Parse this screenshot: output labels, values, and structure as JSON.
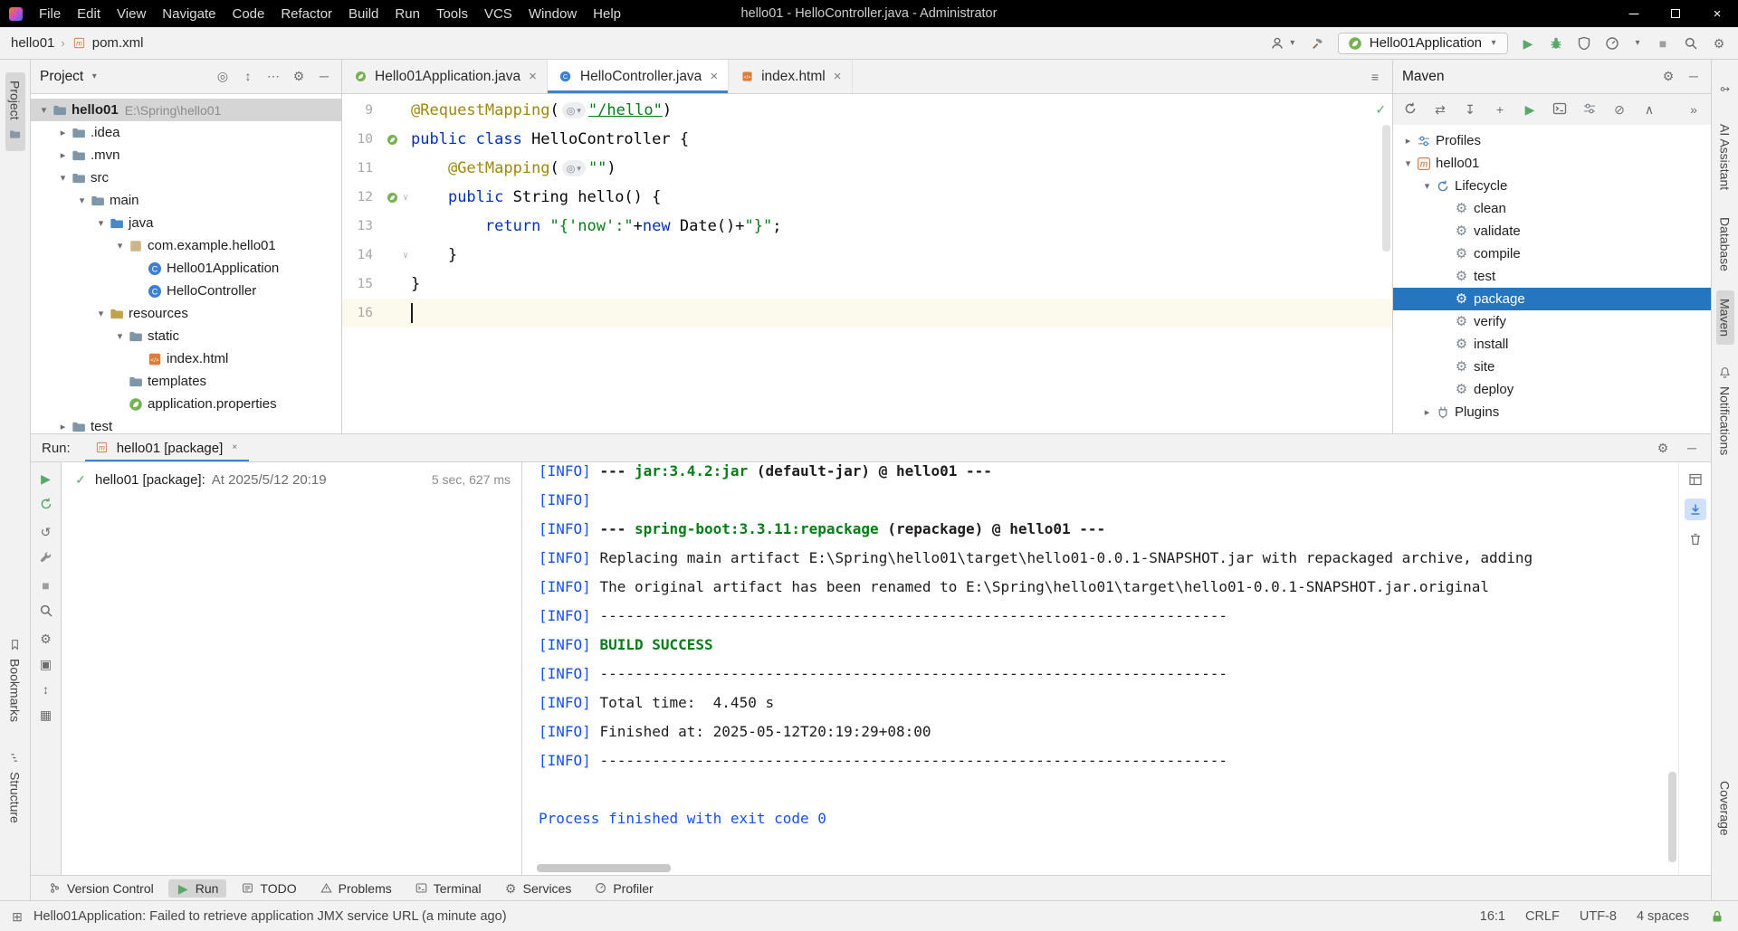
{
  "colors": {
    "accent": "#4083c9",
    "selection_blue": "#2675bf",
    "success_green": "#067d17",
    "info_blue": "#1750eb",
    "keyword_blue": "#0033b3",
    "annotation_olive": "#9e880d"
  },
  "title_bar": {
    "title": "hello01 - HelloController.java - Administrator",
    "menus": [
      "File",
      "Edit",
      "View",
      "Navigate",
      "Code",
      "Refactor",
      "Build",
      "Run",
      "Tools",
      "VCS",
      "Window",
      "Help"
    ]
  },
  "navbar": {
    "breadcrumbs": [
      {
        "label": "hello01",
        "icon": null
      },
      {
        "label": "pom.xml",
        "icon": "maven"
      }
    ],
    "run_config_label": "Hello01Application"
  },
  "stripes": {
    "left_top": [
      {
        "label": "Project",
        "icon": "project",
        "selected": true,
        "icon_after": true
      }
    ],
    "left_bottom": [
      {
        "label": "Bookmarks",
        "icon": "bookmark"
      },
      {
        "label": "Structure",
        "icon": "structure"
      }
    ],
    "right_top": [
      {
        "label": "",
        "icon": "endpoints"
      },
      {
        "label": "AI Assistant",
        "icon": null
      },
      {
        "label": "Database",
        "icon": null
      },
      {
        "label": "Maven",
        "icon": null,
        "selected": true
      },
      {
        "label": "Notifications",
        "icon": "bell"
      }
    ],
    "right_bottom": [
      {
        "label": "Coverage",
        "icon": null
      }
    ]
  },
  "project_panel": {
    "title": "Project",
    "header_icons": [
      "select-target",
      "expand-collapse",
      "view-options",
      "settings",
      "hide"
    ],
    "tree": [
      {
        "indent": 0,
        "chevron": "down",
        "icon": "folder",
        "label": "hello01",
        "path": "E:\\Spring\\hello01",
        "selected": true,
        "bold": true
      },
      {
        "indent": 1,
        "chevron": "right",
        "icon": "folder",
        "label": ".idea"
      },
      {
        "indent": 1,
        "chevron": "right",
        "icon": "folder",
        "label": ".mvn"
      },
      {
        "indent": 1,
        "chevron": "down",
        "icon": "folder",
        "label": "src"
      },
      {
        "indent": 2,
        "chevron": "down",
        "icon": "folder",
        "label": "main"
      },
      {
        "indent": 3,
        "chevron": "down",
        "icon": "folder-source",
        "label": "java"
      },
      {
        "indent": 4,
        "chevron": "down",
        "icon": "package",
        "label": "com.example.hello01"
      },
      {
        "indent": 5,
        "chevron": null,
        "icon": "class",
        "label": "Hello01Application"
      },
      {
        "indent": 5,
        "chevron": null,
        "icon": "class",
        "label": "HelloController"
      },
      {
        "indent": 3,
        "chevron": "down",
        "icon": "folder-resources",
        "label": "resources"
      },
      {
        "indent": 4,
        "chevron": "down",
        "icon": "folder",
        "label": "static"
      },
      {
        "indent": 5,
        "chevron": null,
        "icon": "html-file",
        "label": "index.html"
      },
      {
        "indent": 4,
        "chevron": null,
        "icon": "folder",
        "label": "templates"
      },
      {
        "indent": 4,
        "chevron": null,
        "icon": "spring-config",
        "label": "application.properties"
      },
      {
        "indent": 1,
        "chevron": "right",
        "icon": "folder",
        "label": "test"
      }
    ]
  },
  "editor": {
    "tabs": [
      {
        "label": "Hello01Application.java",
        "icon": "spring-boot",
        "active": false
      },
      {
        "label": "HelloController.java",
        "icon": "class",
        "active": true
      },
      {
        "label": "index.html",
        "icon": "html-file",
        "active": false
      }
    ],
    "lines": [
      {
        "num": "9",
        "segs": [
          {
            "t": "@RequestMapping",
            "c": "ann"
          },
          {
            "t": "(",
            "c": ""
          },
          {
            "inlay": true
          },
          {
            "t": "\"/hello\"",
            "c": "str u"
          },
          {
            "t": ")",
            "c": ""
          }
        ]
      },
      {
        "num": "10",
        "gutter_icons": [
          "spring-bean"
        ],
        "segs": [
          {
            "t": "public class ",
            "c": "kw"
          },
          {
            "t": "HelloController {",
            "c": ""
          }
        ]
      },
      {
        "num": "11",
        "segs": [
          {
            "t": "    ",
            "c": ""
          },
          {
            "t": "@GetMapping",
            "c": "ann"
          },
          {
            "t": "(",
            "c": ""
          },
          {
            "inlay": true
          },
          {
            "t": "\"\"",
            "c": "str"
          },
          {
            "t": ")",
            "c": ""
          }
        ]
      },
      {
        "num": "12",
        "gutter_icons": [
          "spring-bean"
        ],
        "fold": true,
        "segs": [
          {
            "t": "    ",
            "c": ""
          },
          {
            "t": "public ",
            "c": "kw"
          },
          {
            "t": "String hello() {",
            "c": ""
          }
        ]
      },
      {
        "num": "13",
        "segs": [
          {
            "t": "        ",
            "c": ""
          },
          {
            "t": "return ",
            "c": "kw"
          },
          {
            "t": "\"{'now':\"",
            "c": "str"
          },
          {
            "t": "+",
            "c": ""
          },
          {
            "t": "new",
            "c": "kw"
          },
          {
            "t": " Date()+",
            "c": ""
          },
          {
            "t": "\"}\"",
            "c": "str"
          },
          {
            "t": ";",
            "c": ""
          }
        ]
      },
      {
        "num": "14",
        "fold": true,
        "segs": [
          {
            "t": "    }",
            "c": ""
          }
        ]
      },
      {
        "num": "15",
        "segs": [
          {
            "t": "}",
            "c": ""
          }
        ]
      },
      {
        "num": "16",
        "current": true,
        "segs": []
      }
    ]
  },
  "maven_panel": {
    "title": "Maven",
    "header_icons": [
      "settings",
      "hide"
    ],
    "toolbar_icons": [
      "reload",
      "sync",
      "download",
      "add",
      "run-goal",
      "execute",
      "filter",
      "skip-tests",
      "collapse-all",
      "more"
    ],
    "tree": [
      {
        "indent": 0,
        "chevron": "right",
        "icon": "profiles",
        "label": "Profiles"
      },
      {
        "indent": 0,
        "chevron": "down",
        "icon": "maven",
        "label": "hello01"
      },
      {
        "indent": 1,
        "chevron": "down",
        "icon": "lifecycle",
        "label": "Lifecycle"
      },
      {
        "indent": 2,
        "chevron": null,
        "icon": "goal",
        "label": "clean"
      },
      {
        "indent": 2,
        "chevron": null,
        "icon": "goal",
        "label": "validate"
      },
      {
        "indent": 2,
        "chevron": null,
        "icon": "goal",
        "label": "compile"
      },
      {
        "indent": 2,
        "chevron": null,
        "icon": "goal",
        "label": "test"
      },
      {
        "indent": 2,
        "chevron": null,
        "icon": "goal",
        "label": "package",
        "selected": true
      },
      {
        "indent": 2,
        "chevron": null,
        "icon": "goal",
        "label": "verify"
      },
      {
        "indent": 2,
        "chevron": null,
        "icon": "goal",
        "label": "install"
      },
      {
        "indent": 2,
        "chevron": null,
        "icon": "goal",
        "label": "site"
      },
      {
        "indent": 2,
        "chevron": null,
        "icon": "goal",
        "label": "deploy"
      },
      {
        "indent": 1,
        "chevron": "right",
        "icon": "plugins",
        "label": "Plugins"
      }
    ]
  },
  "run_panel": {
    "label": "Run:",
    "tab": {
      "label": "hello01 [package]",
      "icon": "maven"
    },
    "toolbar_icons": [
      "play",
      "rerun",
      "restart",
      "wrench",
      "stop",
      "find",
      "settings",
      "snapshot",
      "swap",
      "grid"
    ],
    "side_icons": [
      {
        "icon": "restore-layout",
        "selected": false
      },
      {
        "icon": "scroll-end",
        "selected": true
      },
      {
        "icon": "clear",
        "selected": false
      }
    ],
    "tree_item": {
      "label": "hello01 [package]:",
      "detail": "At 2025/5/12 20:19",
      "duration": "5 sec, 627 ms"
    },
    "console_lines": [
      [
        {
          "t": "[INFO] ",
          "c": "tag"
        },
        {
          "t": "--- ",
          "c": "b"
        },
        {
          "t": "jar:3.4.2:jar ",
          "c": "goal"
        },
        {
          "t": "(default-jar)",
          "c": "b"
        },
        {
          "t": " @ ",
          "c": "b"
        },
        {
          "t": "hello01",
          "c": "b"
        },
        {
          "t": " ---",
          "c": "b"
        }
      ],
      [
        {
          "t": "[INFO]",
          "c": "tag"
        }
      ],
      [
        {
          "t": "[INFO] ",
          "c": "tag"
        },
        {
          "t": "--- ",
          "c": "b"
        },
        {
          "t": "spring-boot:3.3.11:repackage ",
          "c": "goal"
        },
        {
          "t": "(repackage)",
          "c": "b"
        },
        {
          "t": " @ ",
          "c": "b"
        },
        {
          "t": "hello01",
          "c": "b"
        },
        {
          "t": " ---",
          "c": "b"
        }
      ],
      [
        {
          "t": "[INFO] ",
          "c": "tag"
        },
        {
          "t": "Replacing main artifact E:\\Spring\\hello01\\target\\hello01-0.0.1-SNAPSHOT.jar with repackaged archive, adding",
          "c": ""
        }
      ],
      [
        {
          "t": "[INFO] ",
          "c": "tag"
        },
        {
          "t": "The original artifact has been renamed to E:\\Spring\\hello01\\target\\hello01-0.0.1-SNAPSHOT.jar.original",
          "c": ""
        }
      ],
      [
        {
          "t": "[INFO] ",
          "c": "tag"
        },
        {
          "t": "------------------------------------------------------------------------",
          "c": ""
        }
      ],
      [
        {
          "t": "[INFO] ",
          "c": "tag"
        },
        {
          "t": "BUILD SUCCESS",
          "c": "success"
        }
      ],
      [
        {
          "t": "[INFO] ",
          "c": "tag"
        },
        {
          "t": "------------------------------------------------------------------------",
          "c": ""
        }
      ],
      [
        {
          "t": "[INFO] ",
          "c": "tag"
        },
        {
          "t": "Total time:  4.450 s",
          "c": ""
        }
      ],
      [
        {
          "t": "[INFO] ",
          "c": "tag"
        },
        {
          "t": "Finished at: 2025-05-12T20:19:29+08:00",
          "c": ""
        }
      ],
      [
        {
          "t": "[INFO] ",
          "c": "tag"
        },
        {
          "t": "------------------------------------------------------------------------",
          "c": ""
        }
      ],
      [],
      [
        {
          "t": "Process finished with exit code 0",
          "c": "sys"
        }
      ]
    ]
  },
  "bottom_bar": {
    "items": [
      {
        "label": "Version Control",
        "icon": "branch",
        "selected": false
      },
      {
        "label": "Run",
        "icon": "run",
        "selected": true
      },
      {
        "label": "TODO",
        "icon": "todo",
        "selected": false
      },
      {
        "label": "Problems",
        "icon": "problems",
        "selected": false
      },
      {
        "label": "Terminal",
        "icon": "terminal",
        "selected": false
      },
      {
        "label": "Services",
        "icon": "services",
        "selected": false
      },
      {
        "label": "Profiler",
        "icon": "profiler",
        "selected": false
      }
    ]
  },
  "status_bar": {
    "message": "Hello01Application: Failed to retrieve application JMX service URL (a minute ago)",
    "items": [
      "16:1",
      "CRLF",
      "UTF-8",
      "4 spaces"
    ]
  }
}
